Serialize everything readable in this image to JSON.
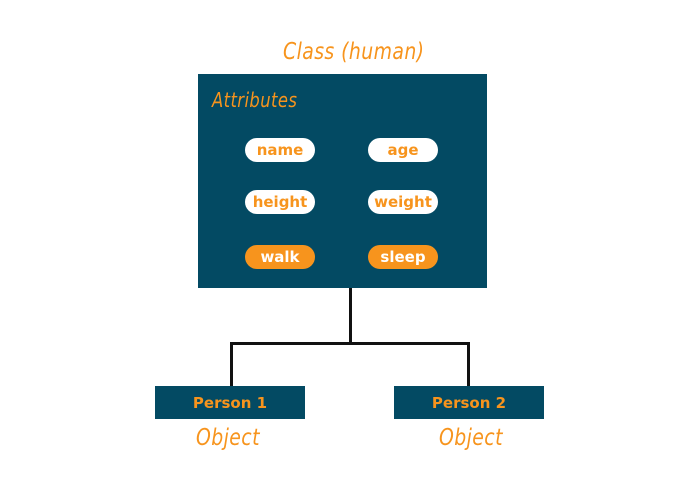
{
  "diagram": {
    "title": "Class (human)",
    "class_box": {
      "section_label": "Attributes",
      "attributes": [
        "name",
        "age",
        "height",
        "weight"
      ],
      "methods": [
        "walk",
        "sleep"
      ]
    },
    "objects": [
      {
        "name": "Person 1",
        "label": "Object"
      },
      {
        "name": "Person 2",
        "label": "Object"
      }
    ],
    "colors": {
      "box": "#034a63",
      "accent": "#f7941d",
      "line": "#111111",
      "pill_fill": "#ffffff"
    }
  }
}
